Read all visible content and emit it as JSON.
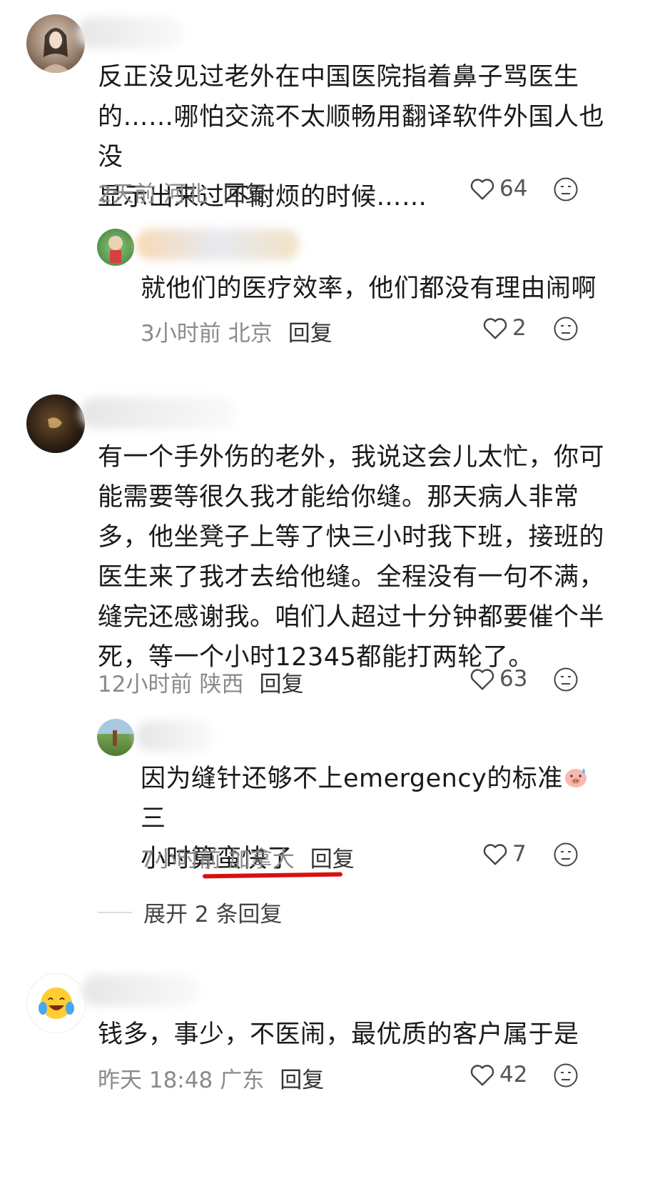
{
  "comments": [
    {
      "text": "反正没见过老外在中国医院指着鼻子骂医生的……哪怕交流不太顺畅用翻译软件外国人也没显示出来过不耐烦的时候……",
      "lines": [
        "反正没见过老外在中国医院指着鼻子骂医生",
        "的……哪怕交流不太顺畅用翻译软件外国人也没",
        "显示出来过不耐烦的时候……"
      ],
      "time": "2天前",
      "location": "河北",
      "reply_label": "回复",
      "likes": "64",
      "replies": [
        {
          "text": "就他们的医疗效率，他们都没有理由闹啊",
          "time": "3小时前",
          "location": "北京",
          "reply_label": "回复",
          "likes": "2"
        }
      ]
    },
    {
      "text": "有一个手外伤的老外，我说这会儿太忙，你可能需要等很久我才能给你缝。那天病人非常多，他坐凳子上等了快三小时我下班，接班的医生来了我才去给他缝。全程没有一句不满，缝完还感谢我。咱们人超过十分钟都要催个半死，等一个小时12345都能打两轮了。",
      "lines": [
        "有一个手外伤的老外，我说这会儿太忙，你可",
        "能需要等很久我才能给你缝。那天病人非常",
        "多，他坐凳子上等了快三小时我下班，接班的",
        "医生来了我才去给他缝。全程没有一句不满，",
        "缝完还感谢我。咱们人超过十分钟都要催个半",
        "死，等一个小时12345都能打两轮了。"
      ],
      "time": "12小时前",
      "location": "陕西",
      "reply_label": "回复",
      "likes": "63",
      "replies": [
        {
          "line1": "因为缝针还够不上emergency的标准",
          "line1_tail": "三",
          "line2": "小时算蛮快了",
          "time": "7小时前",
          "location": "加拿大",
          "reply_label": "回复",
          "likes": "7"
        }
      ],
      "expand_label": "展开 2 条回复"
    },
    {
      "text": "钱多，事少，不医闹，最优质的客户属于是",
      "time": "昨天 18:48",
      "location": "广东",
      "reply_label": "回复",
      "likes": "42"
    }
  ],
  "icons": {
    "like": "heart-outline-icon",
    "dislike": "unimpressed-face-icon",
    "emoji_inline": "pig-sweat-emoji",
    "avatar3_emoji": "laughing-tears-emoji"
  },
  "colors": {
    "annotation_underline": "#d81010",
    "meta_grey": "#8a8a8a"
  }
}
